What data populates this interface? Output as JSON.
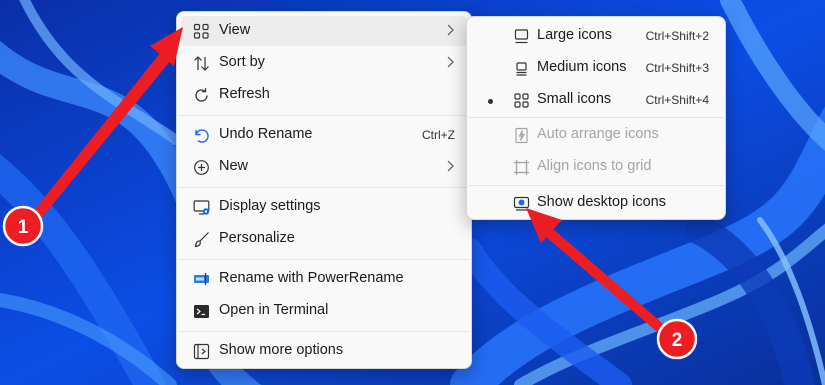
{
  "colors": {
    "accent": "#1a6de0",
    "arrow": "#ee1d23",
    "wallpaper": "#0a3fd0"
  },
  "main_menu": {
    "items": [
      {
        "label": "View",
        "icon": "grid-icon",
        "submenu": true
      },
      {
        "label": "Sort by",
        "icon": "sort-icon",
        "submenu": true
      },
      {
        "label": "Refresh",
        "icon": "refresh-icon"
      },
      {
        "label": "Undo Rename",
        "icon": "undo-icon",
        "shortcut": "Ctrl+Z"
      },
      {
        "label": "New",
        "icon": "plus-circle-icon",
        "submenu": true
      },
      {
        "label": "Display settings",
        "icon": "display-settings-icon"
      },
      {
        "label": "Personalize",
        "icon": "brush-icon"
      },
      {
        "label": "Rename with PowerRename",
        "icon": "powerrename-icon"
      },
      {
        "label": "Open in Terminal",
        "icon": "terminal-icon"
      },
      {
        "label": "Show more options",
        "icon": "more-options-icon"
      }
    ]
  },
  "view_submenu": {
    "items": [
      {
        "label": "Large icons",
        "shortcut": "Ctrl+Shift+2",
        "icon": "large-icons-icon"
      },
      {
        "label": "Medium icons",
        "shortcut": "Ctrl+Shift+3",
        "icon": "medium-icons-icon"
      },
      {
        "label": "Small icons",
        "shortcut": "Ctrl+Shift+4",
        "icon": "small-icons-icon",
        "selected": true
      },
      {
        "label": "Auto arrange icons",
        "icon": "auto-arrange-icon",
        "disabled": true
      },
      {
        "label": "Align icons to grid",
        "icon": "align-grid-icon",
        "disabled": true
      },
      {
        "label": "Show desktop icons",
        "icon": "show-desktop-icon"
      }
    ]
  },
  "annotations": {
    "badge1": "1",
    "badge2": "2"
  }
}
